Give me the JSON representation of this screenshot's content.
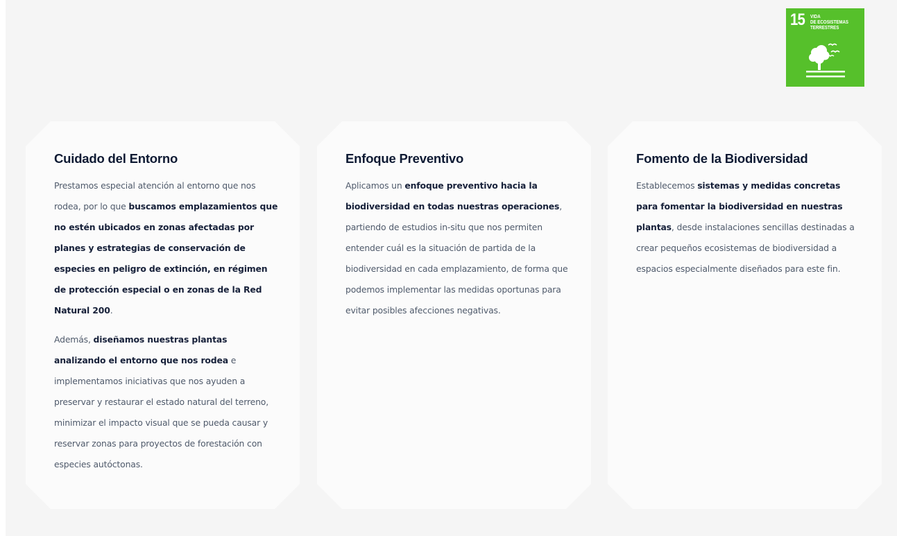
{
  "sdg_badge": {
    "number": "15",
    "title": "VIDA\nDE ECOSISTEMAS\nTERRESTRES",
    "color": "#56c02b",
    "icon": "tree-birds-icon"
  },
  "cards": [
    {
      "title": "Cuidado del Entorno",
      "paragraphs": [
        [
          {
            "text": "Prestamos especial atención al entorno que nos rodea, por lo que "
          },
          {
            "text": "buscamos emplazamientos que no estén ubicados en zonas afectadas por planes y estrategias de conservación de especies en peligro de extinción, en régimen de protección especial o en zonas de la Red Natural 200",
            "bold": true
          },
          {
            "text": "."
          }
        ],
        [
          {
            "text": "Además, "
          },
          {
            "text": "diseñamos nuestras plantas analizando el entorno que nos rodea",
            "bold": true
          },
          {
            "text": " e implementamos iniciativas que nos ayuden a preservar y restaurar el estado natural del terreno, minimizar el impacto visual que se pueda causar y reservar zonas para proyectos de forestación con especies autóctonas."
          }
        ]
      ]
    },
    {
      "title": "Enfoque Preventivo",
      "paragraphs": [
        [
          {
            "text": "Aplicamos un "
          },
          {
            "text": "enfoque preventivo hacia la biodiversidad en todas nuestras operaciones",
            "bold": true
          },
          {
            "text": ", partiendo de estudios in-situ que nos permiten entender cuál es la situación de partida de la biodiversidad en cada emplazamiento, de forma que podemos implementar las medidas oportunas para evitar posibles afecciones negativas."
          }
        ]
      ]
    },
    {
      "title": "Fomento de la Biodiversidad",
      "paragraphs": [
        [
          {
            "text": "Establecemos "
          },
          {
            "text": "sistemas y medidas concretas para fomentar la biodiversidad en nuestras plantas",
            "bold": true
          },
          {
            "text": ", desde instalaciones sencillas destinadas a crear pequeños ecosistemas de biodiversidad a espacios especialmente diseñados para este fin."
          }
        ]
      ]
    }
  ]
}
